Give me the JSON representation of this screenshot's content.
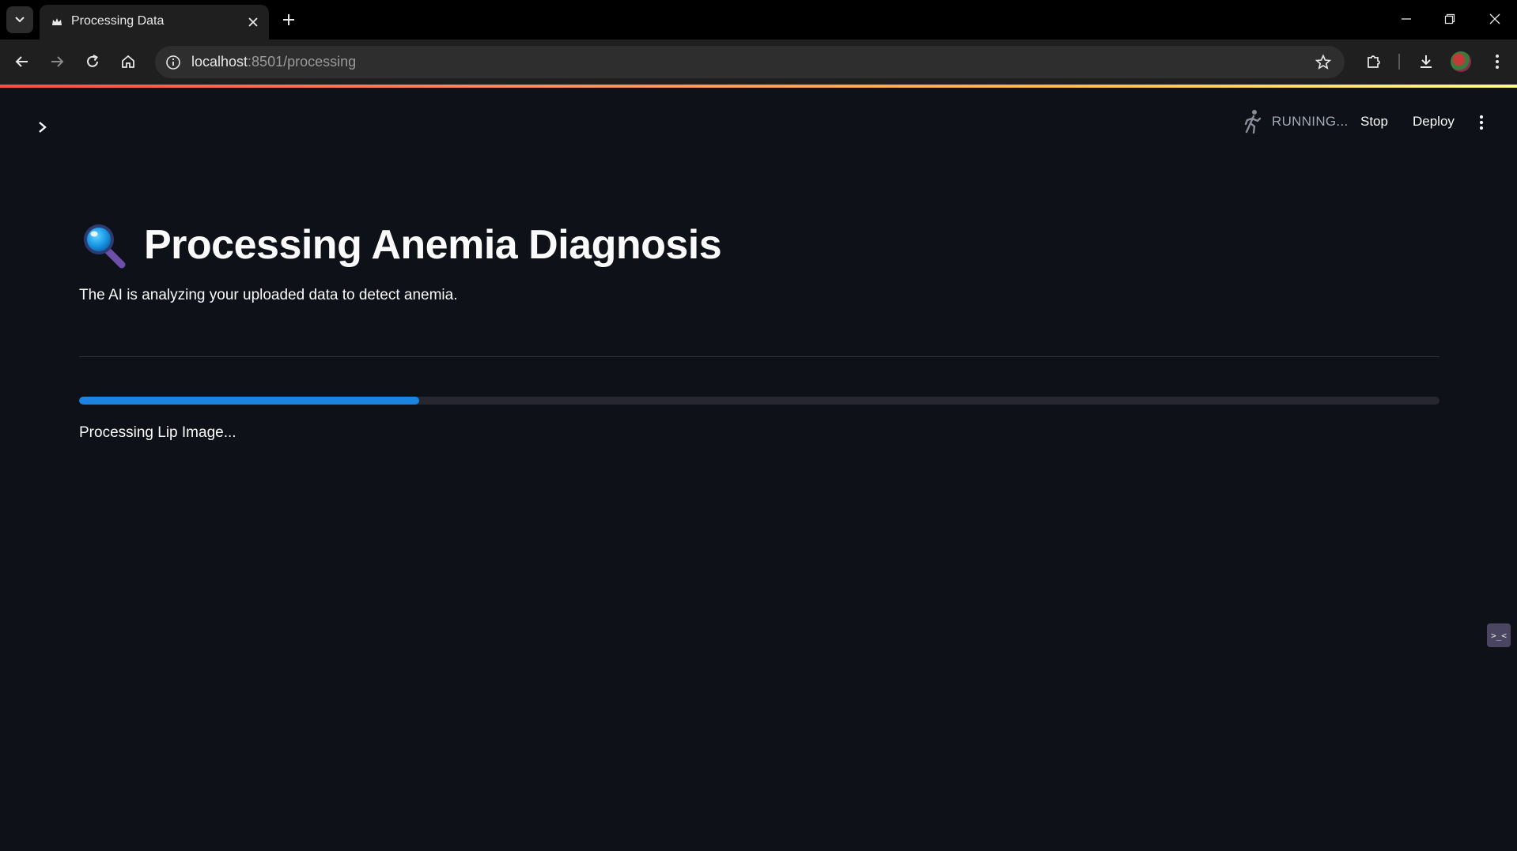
{
  "browser": {
    "tab": {
      "title": "Processing Data",
      "favicon": "crown-icon"
    },
    "address_bar": {
      "host": "localhost",
      "rest": ":8501/processing"
    }
  },
  "app": {
    "header": {
      "status_text": "RUNNING...",
      "stop_label": "Stop",
      "deploy_label": "Deploy"
    },
    "title": {
      "emoji": "🔍",
      "text": "Processing Anemia Diagnosis"
    },
    "subtitle": "The AI is analyzing your uploaded data to detect anemia.",
    "progress": {
      "value": 0.25,
      "text": "Processing Lip Image..."
    },
    "floating_widget_label": ">_<"
  },
  "colors": {
    "background": "#0e1117",
    "progress_fill": "#1c83e1",
    "progress_track": "#262730",
    "text": "#fafafa",
    "status_text": "#a3a8b8"
  }
}
